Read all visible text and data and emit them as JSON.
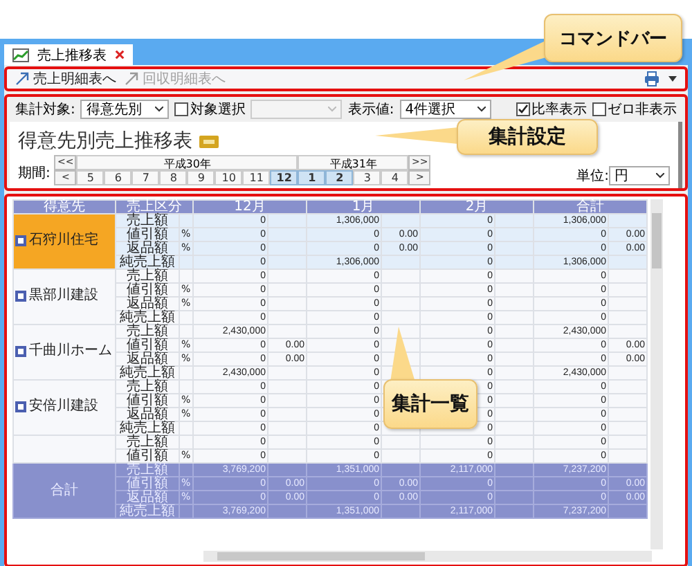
{
  "tab": {
    "title": "売上推移表"
  },
  "commands": [
    {
      "label": "売上明細表へ",
      "disabled": false
    },
    {
      "label": "回収明細表へ",
      "disabled": true
    }
  ],
  "settings": {
    "target_label": "集計対象:",
    "target_value": "得意先別",
    "select_target": {
      "label": "対象選択",
      "checked": false
    },
    "display_label": "表示値:",
    "display_value": "4件選択",
    "ratio": {
      "label": "比率表示",
      "checked": true
    },
    "hide_zero": {
      "label": "ゼロ非表示",
      "checked": false
    }
  },
  "report": {
    "title": "得意先別売上推移表",
    "period_label": "期間:",
    "nav": {
      "first": "<<",
      "prev": "<",
      "next": ">",
      "last": ">>"
    },
    "eras": [
      {
        "label": "平成30年",
        "months": [
          {
            "label": "5",
            "selected": false
          },
          {
            "label": "6",
            "selected": false
          },
          {
            "label": "7",
            "selected": false
          },
          {
            "label": "8",
            "selected": false
          },
          {
            "label": "9",
            "selected": false
          },
          {
            "label": "10",
            "selected": false
          },
          {
            "label": "11",
            "selected": false
          },
          {
            "label": "12",
            "selected": true
          }
        ]
      },
      {
        "label": "平成31年",
        "months": [
          {
            "label": "1",
            "selected": true
          },
          {
            "label": "2",
            "selected": true
          },
          {
            "label": "3",
            "selected": false
          },
          {
            "label": "4",
            "selected": false
          }
        ]
      }
    ],
    "unit_label": "単位:",
    "unit_value": "円"
  },
  "table": {
    "columns": [
      "得意先",
      "売上区分",
      "12月",
      "1月",
      "2月",
      "合計"
    ],
    "groups": [
      {
        "name": "石狩川住宅",
        "selected": true,
        "rows": [
          {
            "label": "売上額",
            "cells": [
              {
                "value": "0"
              },
              {
                "value": "1,306,000"
              },
              {
                "value": "0"
              },
              {
                "value": "1,306,000"
              }
            ]
          },
          {
            "label": "値引額",
            "unit": "%",
            "cells": [
              {
                "value": "0"
              },
              {
                "value": "0",
                "ratio": "0.00"
              },
              {
                "value": "0"
              },
              {
                "value": "0",
                "ratio": "0.00"
              }
            ]
          },
          {
            "label": "返品額",
            "unit": "%",
            "cells": [
              {
                "value": "0"
              },
              {
                "value": "0",
                "ratio": "0.00"
              },
              {
                "value": "0"
              },
              {
                "value": "0",
                "ratio": "0.00"
              }
            ]
          },
          {
            "label": "純売上額",
            "cells": [
              {
                "value": "0"
              },
              {
                "value": "1,306,000"
              },
              {
                "value": "0"
              },
              {
                "value": "1,306,000"
              }
            ]
          }
        ]
      },
      {
        "name": "黒部川建設",
        "selected": false,
        "rows": [
          {
            "label": "売上額",
            "cells": [
              {
                "value": "0"
              },
              {
                "value": "0"
              },
              {
                "value": "0"
              },
              {
                "value": "0"
              }
            ]
          },
          {
            "label": "値引額",
            "unit": "%",
            "cells": [
              {
                "value": "0"
              },
              {
                "value": "0"
              },
              {
                "value": "0"
              },
              {
                "value": "0"
              }
            ]
          },
          {
            "label": "返品額",
            "unit": "%",
            "cells": [
              {
                "value": "0"
              },
              {
                "value": "0"
              },
              {
                "value": "0"
              },
              {
                "value": "0"
              }
            ]
          },
          {
            "label": "純売上額",
            "cells": [
              {
                "value": "0"
              },
              {
                "value": "0"
              },
              {
                "value": "0"
              },
              {
                "value": "0"
              }
            ]
          }
        ]
      },
      {
        "name": "千曲川ホーム",
        "selected": false,
        "rows": [
          {
            "label": "売上額",
            "cells": [
              {
                "value": "2,430,000"
              },
              {
                "value": "0"
              },
              {
                "value": "0"
              },
              {
                "value": "2,430,000"
              }
            ]
          },
          {
            "label": "値引額",
            "unit": "%",
            "cells": [
              {
                "value": "0",
                "ratio": "0.00"
              },
              {
                "value": "0"
              },
              {
                "value": "0"
              },
              {
                "value": "0",
                "ratio": "0.00"
              }
            ]
          },
          {
            "label": "返品額",
            "unit": "%",
            "cells": [
              {
                "value": "0",
                "ratio": "0.00"
              },
              {
                "value": "0"
              },
              {
                "value": "0"
              },
              {
                "value": "0",
                "ratio": "0.00"
              }
            ]
          },
          {
            "label": "純売上額",
            "cells": [
              {
                "value": "2,430,000"
              },
              {
                "value": "0"
              },
              {
                "value": "0"
              },
              {
                "value": "2,430,000"
              }
            ]
          }
        ]
      },
      {
        "name": "安倍川建設",
        "selected": false,
        "rows": [
          {
            "label": "売上額",
            "cells": [
              {
                "value": "0"
              },
              {
                "value": "0"
              },
              {
                "value": "0"
              },
              {
                "value": "0"
              }
            ]
          },
          {
            "label": "値引額",
            "unit": "%",
            "cells": [
              {
                "value": "0"
              },
              {
                "value": "0"
              },
              {
                "value": "0"
              },
              {
                "value": "0"
              }
            ]
          },
          {
            "label": "返品額",
            "unit": "%",
            "cells": [
              {
                "value": "0"
              },
              {
                "value": "0"
              },
              {
                "value": "0"
              },
              {
                "value": "0"
              }
            ]
          },
          {
            "label": "純売上額",
            "cells": [
              {
                "value": "0"
              },
              {
                "value": "0"
              },
              {
                "value": "0"
              },
              {
                "value": "0"
              }
            ]
          }
        ]
      },
      {
        "selected": false,
        "rows": [
          {
            "label": "売上額",
            "cells": [
              {
                "value": "0"
              },
              {
                "value": "0"
              },
              {
                "value": "0"
              },
              {
                "value": "0"
              }
            ]
          },
          {
            "label": "値引額",
            "unit": "%",
            "cells": [
              {
                "value": "0"
              },
              {
                "value": "0"
              },
              {
                "value": "0"
              },
              {
                "value": "0"
              }
            ]
          }
        ]
      }
    ],
    "total": {
      "label": "合計",
      "rows": [
        {
          "label": "売上額",
          "cells": [
            {
              "value": "3,769,200"
            },
            {
              "value": "1,351,000"
            },
            {
              "value": "2,117,000"
            },
            {
              "value": "7,237,200"
            }
          ]
        },
        {
          "label": "値引額",
          "unit": "%",
          "cells": [
            {
              "value": "0",
              "ratio": "0.00"
            },
            {
              "value": "0",
              "ratio": "0.00"
            },
            {
              "value": "0"
            },
            {
              "value": "0",
              "ratio": "0.00"
            }
          ]
        },
        {
          "label": "返品額",
          "unit": "%",
          "cells": [
            {
              "value": "0",
              "ratio": "0.00"
            },
            {
              "value": "0",
              "ratio": "0.00"
            },
            {
              "value": "0"
            },
            {
              "value": "0",
              "ratio": "0.00"
            }
          ]
        },
        {
          "label": "純売上額",
          "cells": [
            {
              "value": "3,769,200"
            },
            {
              "value": "1,351,000"
            },
            {
              "value": "2,117,000"
            },
            {
              "value": "7,237,200"
            }
          ]
        }
      ]
    }
  },
  "callouts": [
    {
      "kind": "command",
      "text": "コマンドバー"
    },
    {
      "kind": "settings",
      "text": "集計設定"
    },
    {
      "kind": "table",
      "text": "集計一覧"
    }
  ]
}
